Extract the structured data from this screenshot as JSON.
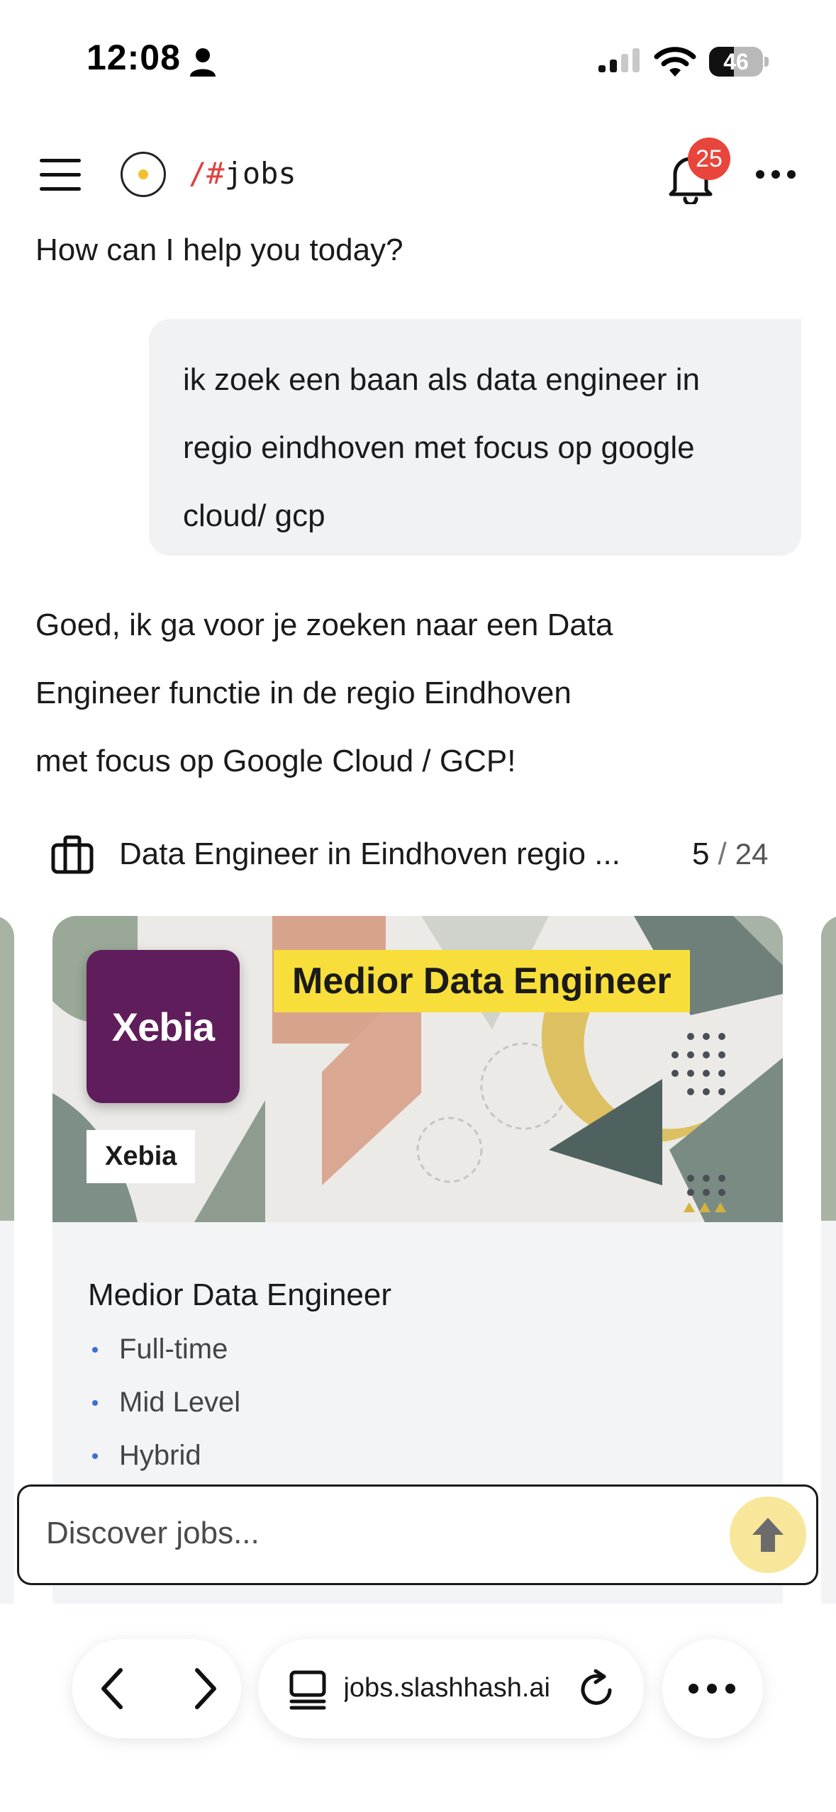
{
  "status_bar": {
    "time": "12:08",
    "battery_level": "46",
    "icons": [
      "person-icon",
      "signal-icon",
      "wifi-icon",
      "battery-icon"
    ]
  },
  "header": {
    "channel_prefix": "/#",
    "channel_name": "jobs",
    "notification_count": "25",
    "icons": [
      "menu-icon",
      "logo-icon",
      "bell-icon",
      "kebab-icon"
    ]
  },
  "chat": {
    "greeting": "How can I help you today?",
    "user_message_lines": [
      "ik zoek een baan als data engineer in",
      "regio eindhoven met focus op google",
      "cloud/ gcp"
    ],
    "assistant_lines": [
      "Goed, ik ga voor je zoeken naar een Data",
      "Engineer functie in de regio Eindhoven",
      "met focus op Google Cloud / GCP!"
    ]
  },
  "results": {
    "title": "Data Engineer in Eindhoven regio ...",
    "current": "5",
    "separator": "/",
    "total": "24"
  },
  "card": {
    "company_logo_text": "Xebia",
    "company_name": "Xebia",
    "banner_title": "Medior Data Engineer",
    "job_title": "Medior Data Engineer",
    "tags": [
      "Full-time",
      "Mid Level",
      "Hybrid"
    ],
    "colors": {
      "logo_bg": "#5f1d5b",
      "banner_title_bg": "#f7de3a",
      "tag_bullet": "#3b6fd8"
    }
  },
  "composer": {
    "placeholder": "Discover jobs...",
    "send_color": "#f8e79a"
  },
  "browser": {
    "url": "jobs.slashhash.ai",
    "icons": [
      "back-icon",
      "forward-icon",
      "tabs-icon",
      "reload-icon",
      "more-icon"
    ]
  }
}
